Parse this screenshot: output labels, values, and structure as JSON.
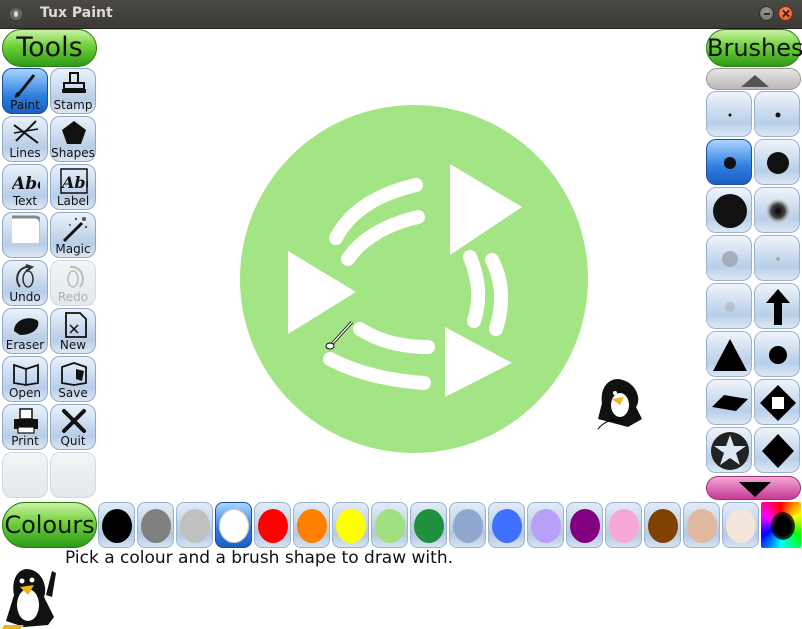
{
  "window": {
    "title": "Tux Paint"
  },
  "tools_panel": {
    "title": "Tools",
    "items": [
      {
        "label": "Paint",
        "icon": "paintbrush-icon",
        "selected": true
      },
      {
        "label": "Stamp",
        "icon": "stamp-icon"
      },
      {
        "label": "Lines",
        "icon": "lines-icon"
      },
      {
        "label": "Shapes",
        "icon": "pentagon-icon"
      },
      {
        "label": "Text",
        "icon": "text-abc-icon"
      },
      {
        "label": "Label",
        "icon": "label-abc-icon"
      },
      {
        "label": "",
        "icon": "blank-square-icon"
      },
      {
        "label": "Magic",
        "icon": "magic-wand-icon"
      },
      {
        "label": "Undo",
        "icon": "undo-icon"
      },
      {
        "label": "Redo",
        "icon": "redo-icon",
        "disabled": true
      },
      {
        "label": "Eraser",
        "icon": "eraser-icon"
      },
      {
        "label": "New",
        "icon": "new-page-icon"
      },
      {
        "label": "Open",
        "icon": "open-book-icon"
      },
      {
        "label": "Save",
        "icon": "save-book-icon"
      },
      {
        "label": "Print",
        "icon": "printer-icon"
      },
      {
        "label": "Quit",
        "icon": "quit-x-icon"
      }
    ]
  },
  "brushes_panel": {
    "title": "Brushes",
    "scroll_up_icon": "triangle-up-icon",
    "scroll_down_icon": "triangle-down-icon",
    "brushes": [
      "tiny-dot",
      "small-dot",
      "medium-dot",
      "large-dot",
      "huge-dot",
      "fuzzy-dot",
      "soft-gray-dot",
      "faint-dot",
      "faint-small-dot",
      "arrow-up-brush",
      "triangle-brush",
      "circle-brush",
      "diamond-flat-brush",
      "diamond-outline-brush",
      "star-brush",
      "diamond-brush"
    ],
    "selected_index": 2
  },
  "colours_panel": {
    "title": "Colours",
    "swatches": [
      "#000000",
      "#808080",
      "#c0c0c0",
      "#ffffff",
      "#ff0000",
      "#ff8000",
      "#ffff00",
      "#a0e080",
      "#209040",
      "#90a8d0",
      "#4070ff",
      "#b8a0f8",
      "#800080",
      "#f8a8d8",
      "#804000",
      "#e0b8a0",
      "#f5e6dc"
    ],
    "selected_index": 3,
    "picker_icon": "rainbow-picker-icon"
  },
  "canvas": {
    "shape_color": "#a3e484"
  },
  "status": {
    "message": "Pick a colour and a brush shape to draw with."
  },
  "icons": {
    "helper": "tux-penguin-icon",
    "app": "tux-app-icon"
  }
}
